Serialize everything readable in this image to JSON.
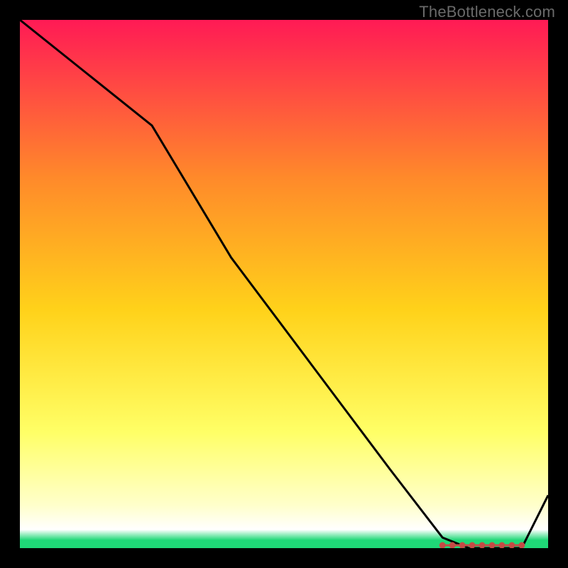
{
  "watermark": "TheBottleneck.com",
  "colors": {
    "bg": "#000000",
    "watermark": "#6a6a6a",
    "line": "#000000",
    "marker": "#c44b45",
    "grad_top": "#ff1a55",
    "grad_mid_upper": "#ff8a2a",
    "grad_mid": "#ffd21a",
    "grad_mid_lower": "#ffff66",
    "grad_pale": "#ffffcc",
    "grad_bottom": "#1fd877"
  },
  "chart_data": {
    "type": "line",
    "title": "",
    "xlabel": "",
    "ylabel": "",
    "xlim": [
      0,
      100
    ],
    "ylim": [
      0,
      100
    ],
    "x": [
      0,
      10,
      25,
      40,
      55,
      70,
      80,
      85,
      90,
      95,
      100
    ],
    "values": [
      100,
      92,
      80,
      55,
      35,
      15,
      2,
      0,
      0,
      0,
      10
    ],
    "low_region": {
      "x_start": 80,
      "x_end": 95,
      "y": 0
    },
    "annotations": []
  }
}
